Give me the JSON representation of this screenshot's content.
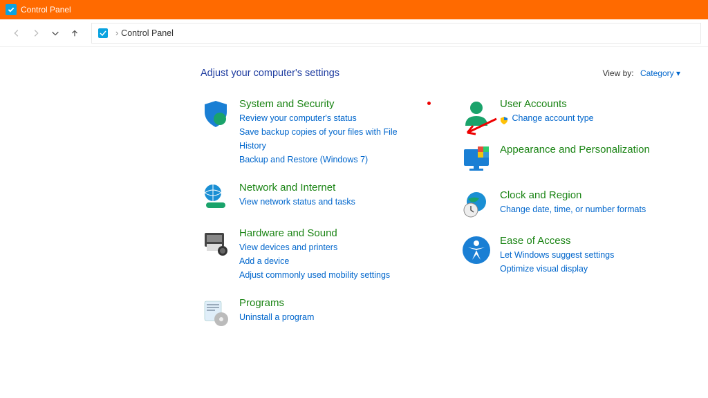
{
  "window": {
    "title": "Control Panel"
  },
  "breadcrumb": {
    "location": "Control Panel"
  },
  "header": {
    "title": "Adjust your computer's settings",
    "viewby_label": "View by:",
    "viewby_value": "Category"
  },
  "categories": {
    "system": {
      "title": "System and Security",
      "links": [
        "Review your computer's status",
        "Save backup copies of your files with File History",
        "Backup and Restore (Windows 7)"
      ]
    },
    "network": {
      "title": "Network and Internet",
      "links": [
        "View network status and tasks"
      ]
    },
    "hardware": {
      "title": "Hardware and Sound",
      "links": [
        "View devices and printers",
        "Add a device",
        "Adjust commonly used mobility settings"
      ]
    },
    "programs": {
      "title": "Programs",
      "links": [
        "Uninstall a program"
      ]
    },
    "user": {
      "title": "User Accounts",
      "links": [
        "Change account type"
      ]
    },
    "appearance": {
      "title": "Appearance and Personalization",
      "links": []
    },
    "clock": {
      "title": "Clock and Region",
      "links": [
        "Change date, time, or number formats"
      ]
    },
    "ease": {
      "title": "Ease of Access",
      "links": [
        "Let Windows suggest settings",
        "Optimize visual display"
      ]
    }
  }
}
